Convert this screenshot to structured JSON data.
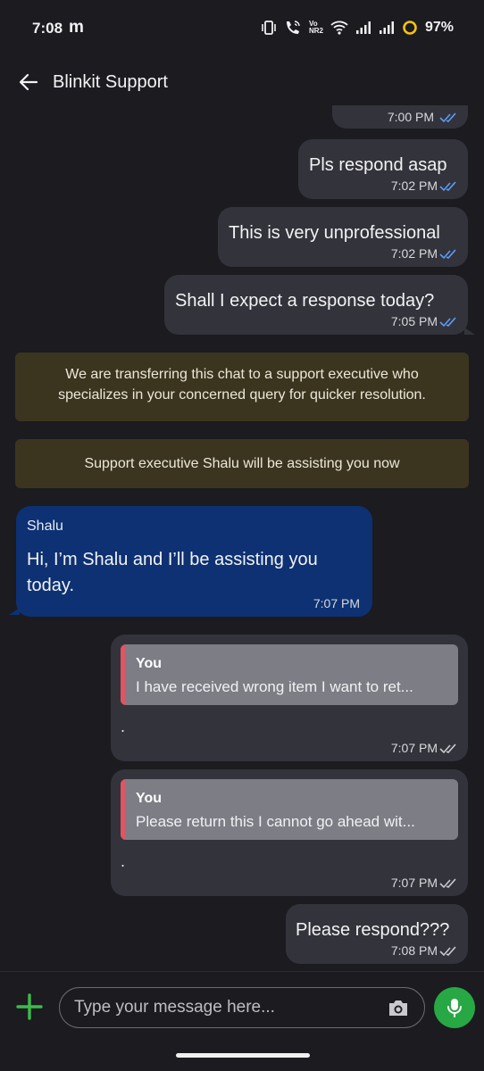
{
  "status_bar": {
    "time": "7:08",
    "carrier_glyph": "m",
    "battery_percent": "97%",
    "icons": [
      "vibrate-icon",
      "wifi-calling-icon",
      "volte-icon",
      "wifi-icon",
      "signal-icon",
      "signal-icon-2",
      "battery-ring-icon"
    ],
    "volte_label": "Vo NR2"
  },
  "header": {
    "title": "Blinkit Support"
  },
  "messages": {
    "partial_time": "7:00 PM",
    "m1": {
      "text": "Pls respond asap",
      "time": "7:02 PM"
    },
    "m2": {
      "text": "This is very unprofessional",
      "time": "7:02 PM"
    },
    "m3": {
      "text": "Shall I expect a response today?",
      "time": "7:05 PM"
    },
    "sys1": {
      "line1": "We are transferring this chat to a support executive who",
      "line2": "specializes in your concerned query for quicker resolution."
    },
    "sys2": {
      "text": "Support executive Shalu will be assisting you now"
    },
    "agent": {
      "sender": "Shalu",
      "line1": "Hi, I’m Shalu and I’ll be assisting you",
      "line2": "today.",
      "time": "7:07 PM"
    },
    "reply1": {
      "quote_name": "You",
      "quote_text": "I have received wrong item I want to ret...",
      "text": ".",
      "time": "7:07 PM"
    },
    "reply2": {
      "quote_name": "You",
      "quote_text": "Please return this I cannot go ahead wit...",
      "text": ".",
      "time": "7:07 PM"
    },
    "m4": {
      "text": "Please respond???",
      "time": "7:08 PM"
    }
  },
  "colors": {
    "background": "#1b1b20",
    "outgoing_bubble": "#33333c",
    "incoming_bubble": "#0d3173",
    "system_banner": "#3b3520",
    "quote_accent": "#e05563",
    "mic_button": "#28a745",
    "read_ticks": "#5b9cf2",
    "delivered_ticks": "#c8c8cc"
  },
  "composer": {
    "placeholder": "Type your message here...",
    "plus_icon": "plus-icon",
    "camera_icon": "camera-icon",
    "mic_icon": "mic-icon"
  }
}
